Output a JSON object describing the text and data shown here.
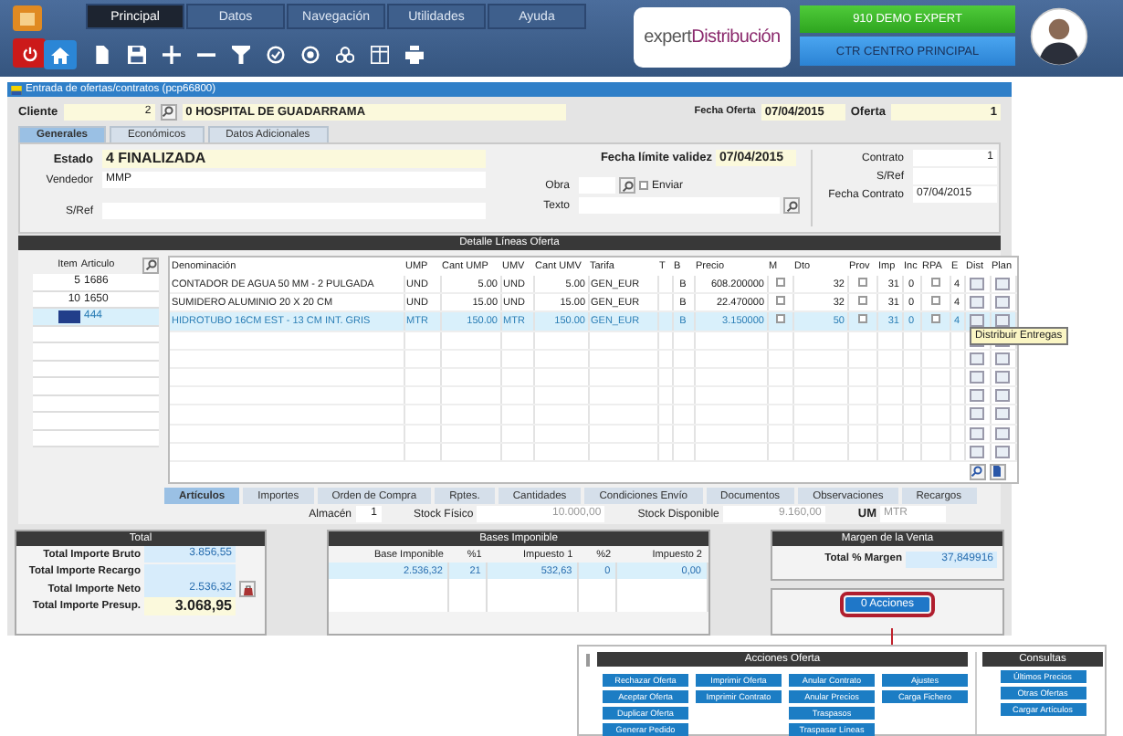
{
  "menu_tabs": [
    {
      "label": "Principal",
      "selected": true
    },
    {
      "label": "Datos",
      "selected": false
    },
    {
      "label": "Navegación",
      "selected": false
    },
    {
      "label": "Utilidades",
      "selected": false
    },
    {
      "label": "Ayuda",
      "selected": false
    }
  ],
  "brand": {
    "prefix": "expert",
    "name": "Distribución"
  },
  "company": "910 DEMO EXPERT",
  "center": "CTR CENTRO PRINCIPAL",
  "form_title": "Entrada de ofertas/contratos (pcp66800)",
  "header": {
    "cliente_label": "Cliente",
    "cliente_code": "2",
    "cliente_name": "0 HOSPITAL DE GUADARRAMA",
    "fecha_label": "Fecha Oferta",
    "fecha": "07/04/2015",
    "oferta_label": "Oferta",
    "oferta": "1"
  },
  "tabs": [
    {
      "label": "Generales",
      "selected": true
    },
    {
      "label": "Económicos",
      "selected": false
    },
    {
      "label": "Datos Adicionales",
      "selected": false
    }
  ],
  "general": {
    "estado_label": "Estado",
    "estado": "4 FINALIZADA",
    "vendedor_label": "Vendedor",
    "vendedor": "MMP",
    "sref_label": "S/Ref",
    "validez_label": "Fecha límite validez",
    "validez": "07/04/2015",
    "obra_label": "Obra",
    "enviar_label": "Enviar",
    "enviar_checked": false,
    "texto_label": "Texto",
    "contrato_label": "Contrato",
    "contrato": "1",
    "sref2_label": "S/Ref",
    "fecha_contrato_label": "Fecha Contrato",
    "fecha_contrato": "07/04/2015"
  },
  "detail_title": "Detalle Líneas Oferta",
  "items": {
    "columns": [
      "Item",
      "Articulo"
    ],
    "rows": [
      {
        "item": "5",
        "articulo": "1686",
        "selected": false
      },
      {
        "item": "10",
        "articulo": "1650",
        "selected": false
      },
      {
        "articulo": "444",
        "selected": true
      }
    ]
  },
  "lines": {
    "columns": [
      "Denominación",
      "UMP",
      "Cant UMP",
      "UMV",
      "Cant UMV",
      "Tarifa",
      "T",
      "B",
      "Precio",
      "M",
      "Dto",
      "Prov",
      "Imp",
      "Inc",
      "RPA",
      "E",
      "Dist",
      "Plan"
    ],
    "rows": [
      {
        "denominacion": "CONTADOR DE AGUA 50 MM - 2 PULGADA",
        "ump": "UND",
        "cant_ump": "5.00",
        "umv": "UND",
        "cant_umv": "5.00",
        "tarifa": "GEN_EUR",
        "b": "B",
        "precio": "608.200000",
        "dto": "32",
        "imp": "31",
        "inc": "0",
        "e": "4",
        "m_checked": false,
        "prov_checked": false,
        "rpa_checked": false,
        "selected": false
      },
      {
        "denominacion": "SUMIDERO ALUMINIO 20 X 20 CM",
        "ump": "UND",
        "cant_ump": "15.00",
        "umv": "UND",
        "cant_umv": "15.00",
        "tarifa": "GEN_EUR",
        "b": "B",
        "precio": "22.470000",
        "dto": "32",
        "imp": "31",
        "inc": "0",
        "e": "4",
        "m_checked": false,
        "prov_checked": false,
        "rpa_checked": false,
        "selected": false
      },
      {
        "denominacion": "HIDROTUBO 16CM EST - 13 CM INT. GRIS",
        "ump": "MTR",
        "cant_ump": "150.00",
        "umv": "MTR",
        "cant_umv": "150.00",
        "tarifa": "GEN_EUR",
        "b": "B",
        "precio": "3.150000",
        "dto": "50",
        "imp": "31",
        "inc": "0",
        "e": "4",
        "m_checked": false,
        "prov_checked": false,
        "rpa_checked": false,
        "selected": true
      }
    ]
  },
  "tooltip": "Distribuir Entregas",
  "sub_tabs": [
    {
      "label": "Artículos",
      "selected": true
    },
    {
      "label": "Importes",
      "selected": false
    },
    {
      "label": "Orden de Compra",
      "selected": false
    },
    {
      "label": "Rptes.",
      "selected": false
    },
    {
      "label": "Cantidades",
      "selected": false
    },
    {
      "label": "Condiciones Envío",
      "selected": false
    },
    {
      "label": "Documentos",
      "selected": false
    },
    {
      "label": "Observaciones",
      "selected": false
    },
    {
      "label": "Recargos",
      "selected": false
    }
  ],
  "stock": {
    "almacen_label": "Almacén",
    "almacen": "1",
    "fisico_label": "Stock Físico",
    "fisico": "10.000,00",
    "disponible_label": "Stock Disponible",
    "disponible": "9.160,00",
    "um_label": "UM",
    "um": "MTR"
  },
  "totals": {
    "title": "Total",
    "rows": [
      {
        "label": "Total Importe Bruto",
        "value": "3.856,55"
      },
      {
        "label": "Total Importe Recargo"
      },
      {
        "label": "Total Importe Neto",
        "value": "2.536,32"
      },
      {
        "label": "Total Importe Presup.",
        "value": "3.068,95"
      }
    ]
  },
  "bases": {
    "title": "Bases Imponible",
    "columns": [
      "Base Imponible",
      "%1",
      "Impuesto 1",
      "%2",
      "Impuesto 2"
    ],
    "rows": [
      [
        "2.536,32",
        "21",
        "532,63",
        "0",
        "0,00"
      ]
    ]
  },
  "margin": {
    "title": "Margen de la Venta",
    "label": "Total % Margen",
    "value": "37,849916"
  },
  "actions_button": "0 Acciones",
  "actions_popup": {
    "title": "Acciones Oferta",
    "columns": [
      [
        "Rechazar Oferta",
        "Aceptar Oferta",
        "Duplicar Oferta",
        "Generar Pedido"
      ],
      [
        "Imprimir Oferta",
        "Imprimir Contrato"
      ],
      [
        "Anular Contrato",
        "Anular Precios",
        "Traspasos",
        "Traspasar Líneas"
      ],
      [
        "Ajustes",
        "Carga Fichero"
      ]
    ],
    "consultas_title": "Consultas",
    "consultas": [
      "Últimos Precios",
      "Otras Ofertas",
      "Cargar Artículos"
    ]
  }
}
